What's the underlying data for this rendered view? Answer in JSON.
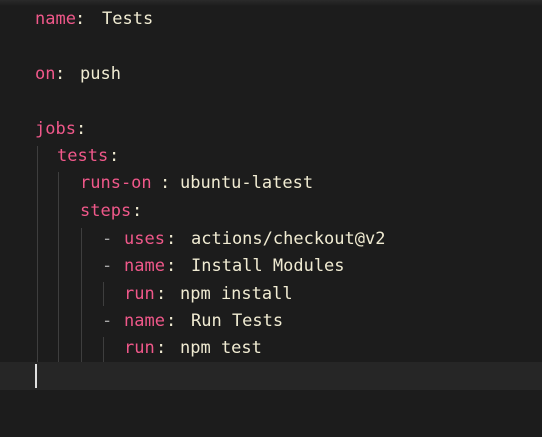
{
  "editor": {
    "lines": [
      {
        "key": "name",
        "sep": ":",
        "value": "Tests"
      },
      {
        "key": "on",
        "sep": ":",
        "value": "push"
      },
      {
        "key": "jobs",
        "sep": ":",
        "value": ""
      },
      {
        "key": "tests",
        "sep": ":",
        "value": ""
      },
      {
        "key": "runs-on",
        "sep": ":",
        "value": "ubuntu-latest"
      },
      {
        "key": "steps",
        "sep": ":",
        "value": ""
      },
      {
        "dash": "-",
        "key": "uses",
        "sep": ":",
        "value": "actions/checkout@v2"
      },
      {
        "dash": "-",
        "key": "name",
        "sep": ":",
        "value": "Install Modules"
      },
      {
        "key": "run",
        "sep": ":",
        "value": "npm install"
      },
      {
        "dash": "-",
        "key": "name",
        "sep": ":",
        "value": "Run Tests"
      },
      {
        "key": "run",
        "sep": ":",
        "value": "npm test"
      }
    ]
  },
  "colors": {
    "background": "#1c1c1c",
    "key": "#f0588a",
    "value": "#f0ebd2",
    "indent_guide": "#3e3e3e",
    "current_line": "#262626"
  }
}
